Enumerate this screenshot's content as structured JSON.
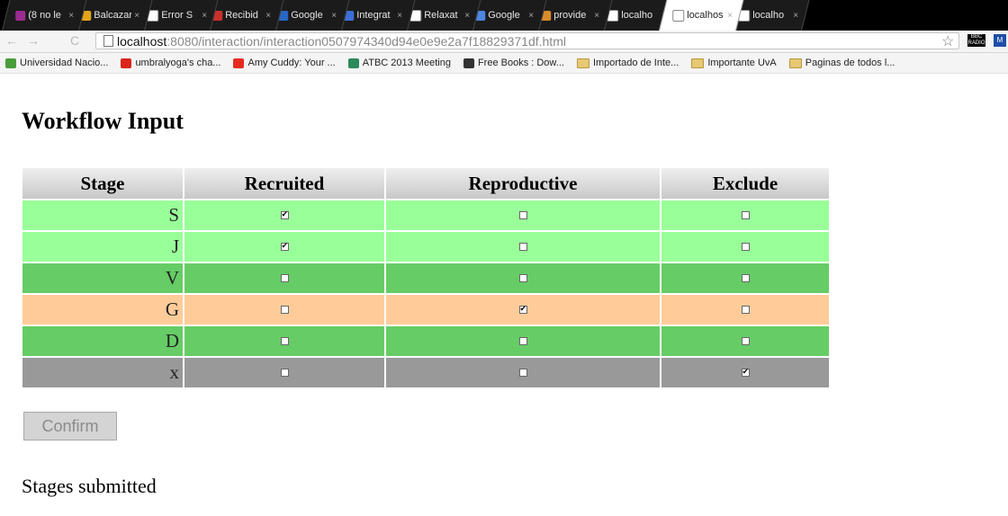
{
  "browser": {
    "tabs": [
      {
        "label": "(8 no le",
        "icon": "social-icon",
        "color": "#9b2c8f"
      },
      {
        "label": "Balcazar",
        "icon": "o-icon",
        "color": "#e3a21a"
      },
      {
        "label": "Error S",
        "icon": "page-icon",
        "color": "#ffffff"
      },
      {
        "label": "Recibid",
        "icon": "mail-icon",
        "color": "#c9302c"
      },
      {
        "label": "Google",
        "icon": "calendar-icon",
        "color": "#2966c4"
      },
      {
        "label": "Integrat",
        "icon": "x-icon",
        "color": "#3a6fd8"
      },
      {
        "label": "Relaxat",
        "icon": "page-icon",
        "color": "#ffffff"
      },
      {
        "label": "Google",
        "icon": "translate-icon",
        "color": "#4b86e0"
      },
      {
        "label": "provide",
        "icon": "app-icon",
        "color": "#d8892b"
      },
      {
        "label": "localho",
        "icon": "page-icon",
        "color": "#ffffff"
      },
      {
        "label": "localhos",
        "icon": "page-icon",
        "color": "#ffffff",
        "active": true
      },
      {
        "label": "localho",
        "icon": "page-icon",
        "color": "#ffffff"
      }
    ],
    "tab_close": "×",
    "address": {
      "host": "localhost",
      "path": ":8080/interaction/interaction0507974340d94e0e9e2a7f18829371df.html"
    },
    "extensions": {
      "radio_label": "BBC RADIO",
      "ext2_label": "M"
    },
    "bookmarks": [
      {
        "label": "Universidad Nacio...",
        "icon": "leaf-icon",
        "color": "#4a9d3a"
      },
      {
        "label": "umbralyoga's cha...",
        "icon": "youtube-icon",
        "color": "#d9251b"
      },
      {
        "label": "Amy Cuddy: Your ...",
        "icon": "ted-icon",
        "color": "#e62b1e"
      },
      {
        "label": "ATBC 2013 Meeting",
        "icon": "bird-icon",
        "color": "#2a8a5a"
      },
      {
        "label": "Free Books : Dow...",
        "icon": "archive-icon",
        "color": "#333333"
      },
      {
        "label": "Importado de Inte...",
        "icon": "folder-icon",
        "color": "#e7c873"
      },
      {
        "label": "Importante UvA",
        "icon": "folder-icon",
        "color": "#e7c873"
      },
      {
        "label": "Paginas de todos l...",
        "icon": "folder-icon",
        "color": "#e7c873"
      }
    ]
  },
  "page": {
    "title": "Workflow Input",
    "columns": [
      "Stage",
      "Recruited",
      "Reproductive",
      "Exclude"
    ],
    "rows": [
      {
        "stage": "S",
        "color": "#99ff99",
        "recruited": true,
        "reproductive": false,
        "exclude": false
      },
      {
        "stage": "J",
        "color": "#99ff99",
        "recruited": true,
        "reproductive": false,
        "exclude": false
      },
      {
        "stage": "V",
        "color": "#66cc66",
        "recruited": false,
        "reproductive": false,
        "exclude": false
      },
      {
        "stage": "G",
        "color": "#ffcc99",
        "recruited": false,
        "reproductive": true,
        "exclude": false
      },
      {
        "stage": "D",
        "color": "#66cc66",
        "recruited": false,
        "reproductive": false,
        "exclude": false
      },
      {
        "stage": "x",
        "color": "#999999",
        "recruited": false,
        "reproductive": false,
        "exclude": true
      }
    ],
    "confirm_label": "Confirm",
    "status": "Stages submitted"
  }
}
